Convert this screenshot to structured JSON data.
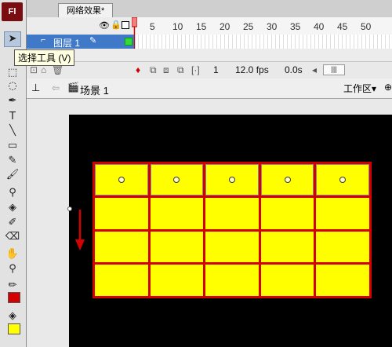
{
  "app": {
    "logo_text": "Fl"
  },
  "tooltip": {
    "text": "选择工具 (V)"
  },
  "document_tab": {
    "title": "网络效果*"
  },
  "timeline": {
    "frame_ticks": [
      "5",
      "10",
      "15",
      "20",
      "25",
      "30",
      "35",
      "40",
      "45",
      "50"
    ],
    "layer_name": "图层 1"
  },
  "status_bar": {
    "current_frame": "1",
    "fps": "12.0 fps",
    "time": "0.0s"
  },
  "edit_bar": {
    "scene_label": "场景 1",
    "workspace_label": "工作区"
  },
  "colors": {
    "stroke": "#d40000",
    "fill": "#ffff00",
    "stage": "#000000"
  },
  "stage_grid": {
    "rows": 4,
    "cols": 5,
    "circle_row": 0
  }
}
